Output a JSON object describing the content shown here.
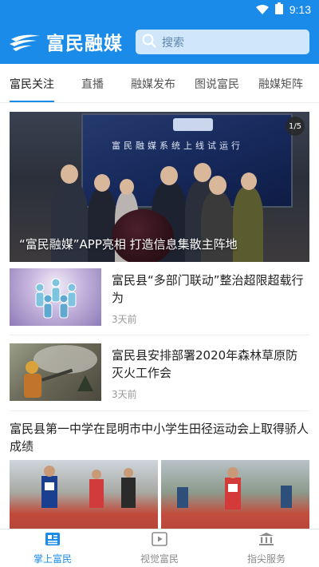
{
  "status_bar": {
    "time": "9:13"
  },
  "header": {
    "app_name": "富民融媒",
    "search_placeholder": "搜索",
    "brand_color": "#1a8be8"
  },
  "tabs": [
    {
      "label": "富民关注",
      "active": true
    },
    {
      "label": "直播"
    },
    {
      "label": "融媒发布"
    },
    {
      "label": "图说富民"
    },
    {
      "label": "融媒矩阵"
    }
  ],
  "banner": {
    "caption": "“富民融媒”APP亮相 打造信息集散主阵地",
    "counter": "1/5",
    "screen_text": "富民融媒系统上线试运行"
  },
  "news": [
    {
      "title": "富民县“多部门联动”整治超限超载行为",
      "time": "3天前",
      "thumb_icon": "paper-people-image"
    },
    {
      "title": "富民县安排部署2020年森林草原防灭火工作会",
      "time": "3天前",
      "thumb_icon": "firefighter-image"
    }
  ],
  "feature": {
    "title": "富民县第一中学在昆明市中小学生田径运动会上取得骄人成绩"
  },
  "bottom_nav": [
    {
      "label": "掌上富民",
      "icon": "newspaper-icon",
      "active": true
    },
    {
      "label": "视觉富民",
      "icon": "video-icon"
    },
    {
      "label": "指尖服务",
      "icon": "building-icon"
    }
  ]
}
